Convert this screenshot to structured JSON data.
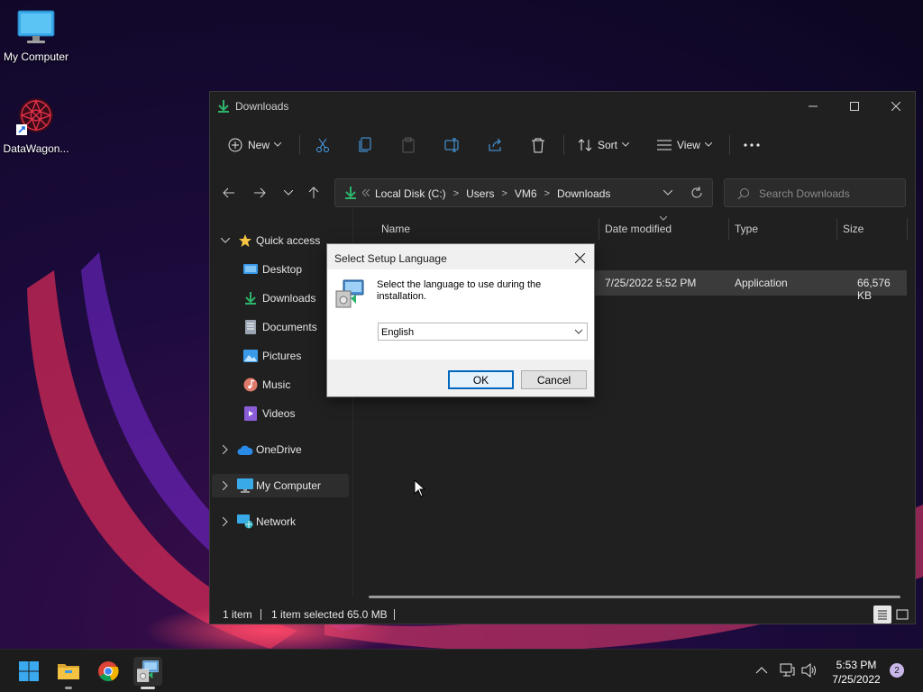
{
  "desktop": {
    "icons": [
      {
        "label": "My Computer"
      },
      {
        "label": "DataWagon..."
      }
    ]
  },
  "explorer": {
    "title": "Downloads",
    "toolbar": {
      "new_label": "New",
      "sort_label": "Sort",
      "view_label": "View"
    },
    "address": {
      "crumbs": [
        "Local Disk (C:)",
        "Users",
        "VM6",
        "Downloads"
      ]
    },
    "search": {
      "placeholder": "Search Downloads"
    },
    "nav": {
      "quick_access": "Quick access",
      "items": [
        "Desktop",
        "Downloads",
        "Documents",
        "Pictures",
        "Music",
        "Videos"
      ],
      "onedrive": "OneDrive",
      "my_computer": "My Computer",
      "network": "Network"
    },
    "columns": {
      "name": "Name",
      "date": "Date modified",
      "type": "Type",
      "size": "Size"
    },
    "rows": [
      {
        "date": "7/25/2022 5:52 PM",
        "type": "Application",
        "size": "66,576 KB"
      }
    ],
    "status": {
      "count": "1 item",
      "selected": "1 item selected",
      "size": "65.0 MB"
    }
  },
  "dialog": {
    "title": "Select Setup Language",
    "message": "Select the language to use during the installation.",
    "selected_language": "English",
    "ok_label": "OK",
    "cancel_label": "Cancel"
  },
  "taskbar": {
    "time": "5:53 PM",
    "date": "7/25/2022",
    "notifications": "2"
  },
  "colors": {
    "accent": "#0067c0",
    "downloads_green": "#2db36b",
    "folder_yellow": "#f5c242"
  }
}
